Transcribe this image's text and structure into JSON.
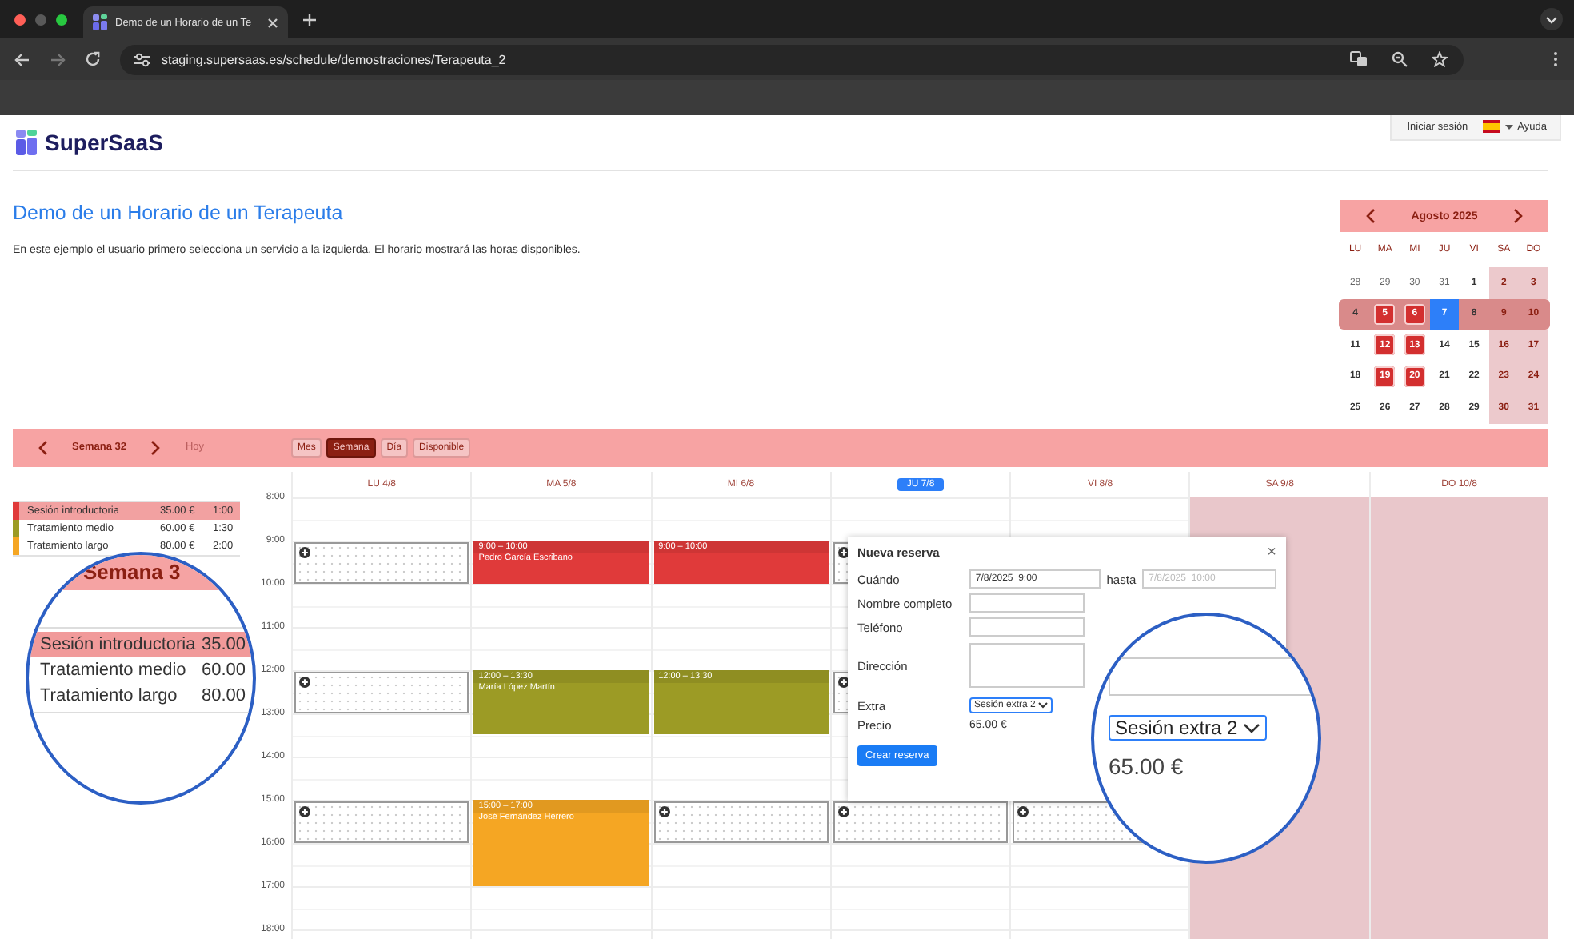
{
  "browser": {
    "tab_title": "Demo de un Horario de un Te",
    "url": "staging.supersaas.es/schedule/demostraciones/Terapeuta_2"
  },
  "header": {
    "logo": "SuperSaaS",
    "login": "Iniciar sesión",
    "help": "Ayuda"
  },
  "intro": {
    "title": "Demo de un Horario de un Terapeuta",
    "description": "En este ejemplo el usuario primero selecciona un servicio a la izquierda. El horario mostrará las horas disponibles."
  },
  "mini_calendar": {
    "month": "Agosto 2025",
    "weekdays": [
      "LU",
      "MA",
      "MI",
      "JU",
      "VI",
      "SA",
      "DO"
    ],
    "weeks": [
      {
        "selected": false,
        "days": [
          {
            "day": "28",
            "outside": true,
            "booked": false,
            "today": false
          },
          {
            "day": "29",
            "outside": true,
            "booked": false,
            "today": false
          },
          {
            "day": "30",
            "outside": true,
            "booked": false,
            "today": false
          },
          {
            "day": "31",
            "outside": true,
            "booked": false,
            "today": false
          },
          {
            "day": "1",
            "outside": false,
            "booked": false,
            "today": false
          },
          {
            "day": "2",
            "outside": false,
            "booked": false,
            "today": false
          },
          {
            "day": "3",
            "outside": false,
            "booked": false,
            "today": false
          }
        ]
      },
      {
        "selected": true,
        "days": [
          {
            "day": "4",
            "outside": false,
            "booked": false,
            "today": false
          },
          {
            "day": "5",
            "outside": false,
            "booked": true,
            "today": false
          },
          {
            "day": "6",
            "outside": false,
            "booked": true,
            "today": false
          },
          {
            "day": "7",
            "outside": false,
            "booked": false,
            "today": true
          },
          {
            "day": "8",
            "outside": false,
            "booked": false,
            "today": false
          },
          {
            "day": "9",
            "outside": false,
            "booked": false,
            "today": false
          },
          {
            "day": "10",
            "outside": false,
            "booked": false,
            "today": false
          }
        ]
      },
      {
        "selected": false,
        "days": [
          {
            "day": "11",
            "outside": false,
            "booked": false,
            "today": false
          },
          {
            "day": "12",
            "outside": false,
            "booked": true,
            "today": false
          },
          {
            "day": "13",
            "outside": false,
            "booked": true,
            "today": false
          },
          {
            "day": "14",
            "outside": false,
            "booked": false,
            "today": false
          },
          {
            "day": "15",
            "outside": false,
            "booked": false,
            "today": false
          },
          {
            "day": "16",
            "outside": false,
            "booked": false,
            "today": false
          },
          {
            "day": "17",
            "outside": false,
            "booked": false,
            "today": false
          }
        ]
      },
      {
        "selected": false,
        "days": [
          {
            "day": "18",
            "outside": false,
            "booked": false,
            "today": false
          },
          {
            "day": "19",
            "outside": false,
            "booked": true,
            "today": false
          },
          {
            "day": "20",
            "outside": false,
            "booked": true,
            "today": false
          },
          {
            "day": "21",
            "outside": false,
            "booked": false,
            "today": false
          },
          {
            "day": "22",
            "outside": false,
            "booked": false,
            "today": false
          },
          {
            "day": "23",
            "outside": false,
            "booked": false,
            "today": false
          },
          {
            "day": "24",
            "outside": false,
            "booked": false,
            "today": false
          }
        ]
      },
      {
        "selected": false,
        "days": [
          {
            "day": "25",
            "outside": false,
            "booked": false,
            "today": false
          },
          {
            "day": "26",
            "outside": false,
            "booked": false,
            "today": false
          },
          {
            "day": "27",
            "outside": false,
            "booked": false,
            "today": false
          },
          {
            "day": "28",
            "outside": false,
            "booked": false,
            "today": false
          },
          {
            "day": "29",
            "outside": false,
            "booked": false,
            "today": false
          },
          {
            "day": "30",
            "outside": false,
            "booked": false,
            "today": false
          },
          {
            "day": "31",
            "outside": false,
            "booked": false,
            "today": false
          }
        ]
      }
    ]
  },
  "toolbar": {
    "week": "Semana 32",
    "today": {
      "label": "Hoy",
      "disabled": true
    },
    "views": [
      {
        "label": "Mes",
        "selected": false
      },
      {
        "label": "Semana",
        "selected": true
      },
      {
        "label": "Día",
        "selected": false
      },
      {
        "label": "Disponible",
        "selected": false
      }
    ]
  },
  "services": [
    {
      "name": "Sesión introductoria",
      "price": "35.00 €",
      "duration": "1:00",
      "color": "#e03a3a",
      "selected": true
    },
    {
      "name": "Tratamiento medio",
      "price": "60.00 €",
      "duration": "1:30",
      "color": "#9c9b25",
      "selected": false
    },
    {
      "name": "Tratamiento largo",
      "price": "80.00 €",
      "duration": "2:00",
      "color": "#f5a623",
      "selected": false
    }
  ],
  "schedule": {
    "hours": [
      "8:00",
      "9:00",
      "10:00",
      "11:00",
      "12:00",
      "13:00",
      "14:00",
      "15:00",
      "16:00",
      "17:00",
      "18:00"
    ],
    "days": [
      {
        "label": "LU 4/8",
        "today": false,
        "closed": false,
        "slots": [
          false,
          true,
          false,
          false,
          true,
          false,
          false,
          true,
          false,
          false,
          false
        ]
      },
      {
        "label": "MA 5/8",
        "today": false,
        "closed": false,
        "slots": [
          false,
          false,
          false,
          false,
          false,
          false,
          false,
          false,
          false,
          false,
          false
        ],
        "items": [
          {
            "kind": "booking",
            "time": "9:00 – 10:00",
            "name": "Pedro García Escribano",
            "color": "#e03a3a"
          },
          {
            "kind": "booking",
            "time": "12:00 – 13:30",
            "name": "María López Martín",
            "color": "#9c9b25"
          },
          {
            "kind": "booking",
            "time": "15:00 – 17:00",
            "name": "José Fernández Herrero",
            "color": "#f5a623"
          }
        ]
      },
      {
        "label": "MI 6/8",
        "today": false,
        "closed": false,
        "slots": [
          false,
          false,
          false,
          false,
          false,
          false,
          false,
          true,
          false,
          false,
          false
        ],
        "items": [
          {
            "kind": "booking",
            "time": "9:00 – 10:00",
            "color": "#e03a3a"
          },
          {
            "kind": "booking",
            "time": "12:00 – 13:30",
            "color": "#9c9b25"
          }
        ]
      },
      {
        "label": "JU 7/8",
        "today": true,
        "closed": false,
        "slots": [
          false,
          true,
          false,
          false,
          true,
          false,
          false,
          true,
          false,
          false,
          false
        ]
      },
      {
        "label": "VI 8/8",
        "today": false,
        "closed": false,
        "slots": [
          false,
          false,
          false,
          false,
          false,
          false,
          false,
          true,
          false,
          false,
          false
        ]
      },
      {
        "label": "SA 9/8",
        "today": false,
        "closed": true,
        "slots": [
          false,
          false,
          false,
          false,
          false,
          false,
          false,
          false,
          false,
          false,
          false
        ]
      },
      {
        "label": "DO 10/8",
        "today": false,
        "closed": true,
        "slots": [
          false,
          false,
          false,
          false,
          false,
          false,
          false,
          false,
          false,
          false,
          false
        ]
      }
    ]
  },
  "booking_form": {
    "title": "Nueva reserva",
    "close": "×",
    "fields": [
      {
        "kind": "range",
        "label": "Cuándo",
        "value": "7/8/2025  9:00",
        "between": "hasta",
        "end_value": "7/8/2025  10:00"
      },
      {
        "kind": "text",
        "label": "Nombre completo"
      },
      {
        "kind": "text",
        "label": "Teléfono"
      },
      {
        "kind": "textarea",
        "label": "Dirección"
      },
      {
        "kind": "select",
        "label": "Extra",
        "value": "Sesión extra 2"
      },
      {
        "kind": "static",
        "label": "Precio",
        "value": "65.00 €"
      }
    ],
    "submit": "Crear reserva"
  },
  "magnifiers": [
    {
      "kind": "services",
      "bar_text": "Semana 3",
      "rows": [
        {
          "name": "Sesión introductoria",
          "price": "35.00",
          "selected": true
        },
        {
          "name": "Tratamiento medio",
          "price": "60.00",
          "selected": false
        },
        {
          "name": "Tratamiento largo",
          "price": "80.00",
          "selected": false
        }
      ]
    },
    {
      "kind": "extra",
      "select": "Sesión extra 2",
      "price": "65.00 €"
    }
  ]
}
